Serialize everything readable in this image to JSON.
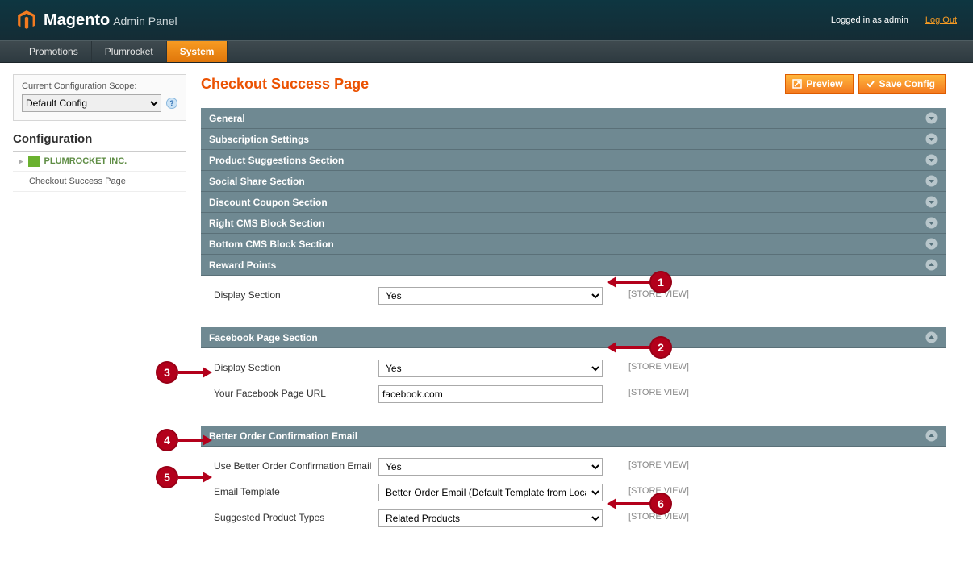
{
  "header": {
    "brand": "Magento",
    "brand_suffix": "Admin Panel",
    "logged_in_text": "Logged in as admin",
    "logout_label": "Log Out"
  },
  "nav": {
    "items": [
      "Promotions",
      "Plumrocket",
      "System"
    ],
    "active_index": 2
  },
  "sidebar": {
    "scope_label": "Current Configuration Scope:",
    "scope_value": "Default Config",
    "config_title": "Configuration",
    "group_name": "PLUMROCKET INC.",
    "subnav_item": "Checkout Success Page"
  },
  "page": {
    "title": "Checkout Success Page",
    "preview_label": "Preview",
    "save_label": "Save Config"
  },
  "sections": {
    "collapsed": [
      "General",
      "Subscription Settings",
      "Product Suggestions Section",
      "Social Share Section",
      "Discount Coupon Section",
      "Right CMS Block Section",
      "Bottom CMS Block Section"
    ],
    "reward_points": {
      "title": "Reward Points",
      "display_section_label": "Display Section",
      "display_section_value": "Yes",
      "scope_text": "[STORE VIEW]"
    },
    "facebook": {
      "title": "Facebook Page Section",
      "display_section_label": "Display Section",
      "display_section_value": "Yes",
      "url_label": "Your Facebook Page URL",
      "url_value": "facebook.com",
      "scope_text": "[STORE VIEW]"
    },
    "better_email": {
      "title": "Better Order Confirmation Email",
      "use_label": "Use Better Order Confirmation Email",
      "use_value": "Yes",
      "template_label": "Email Template",
      "template_value": "Better Order Email (Default Template from Locale)",
      "suggested_label": "Suggested Product Types",
      "suggested_value": "Related Products",
      "scope_text": "[STORE VIEW]"
    }
  },
  "callouts": [
    "1",
    "2",
    "3",
    "4",
    "5",
    "6"
  ]
}
